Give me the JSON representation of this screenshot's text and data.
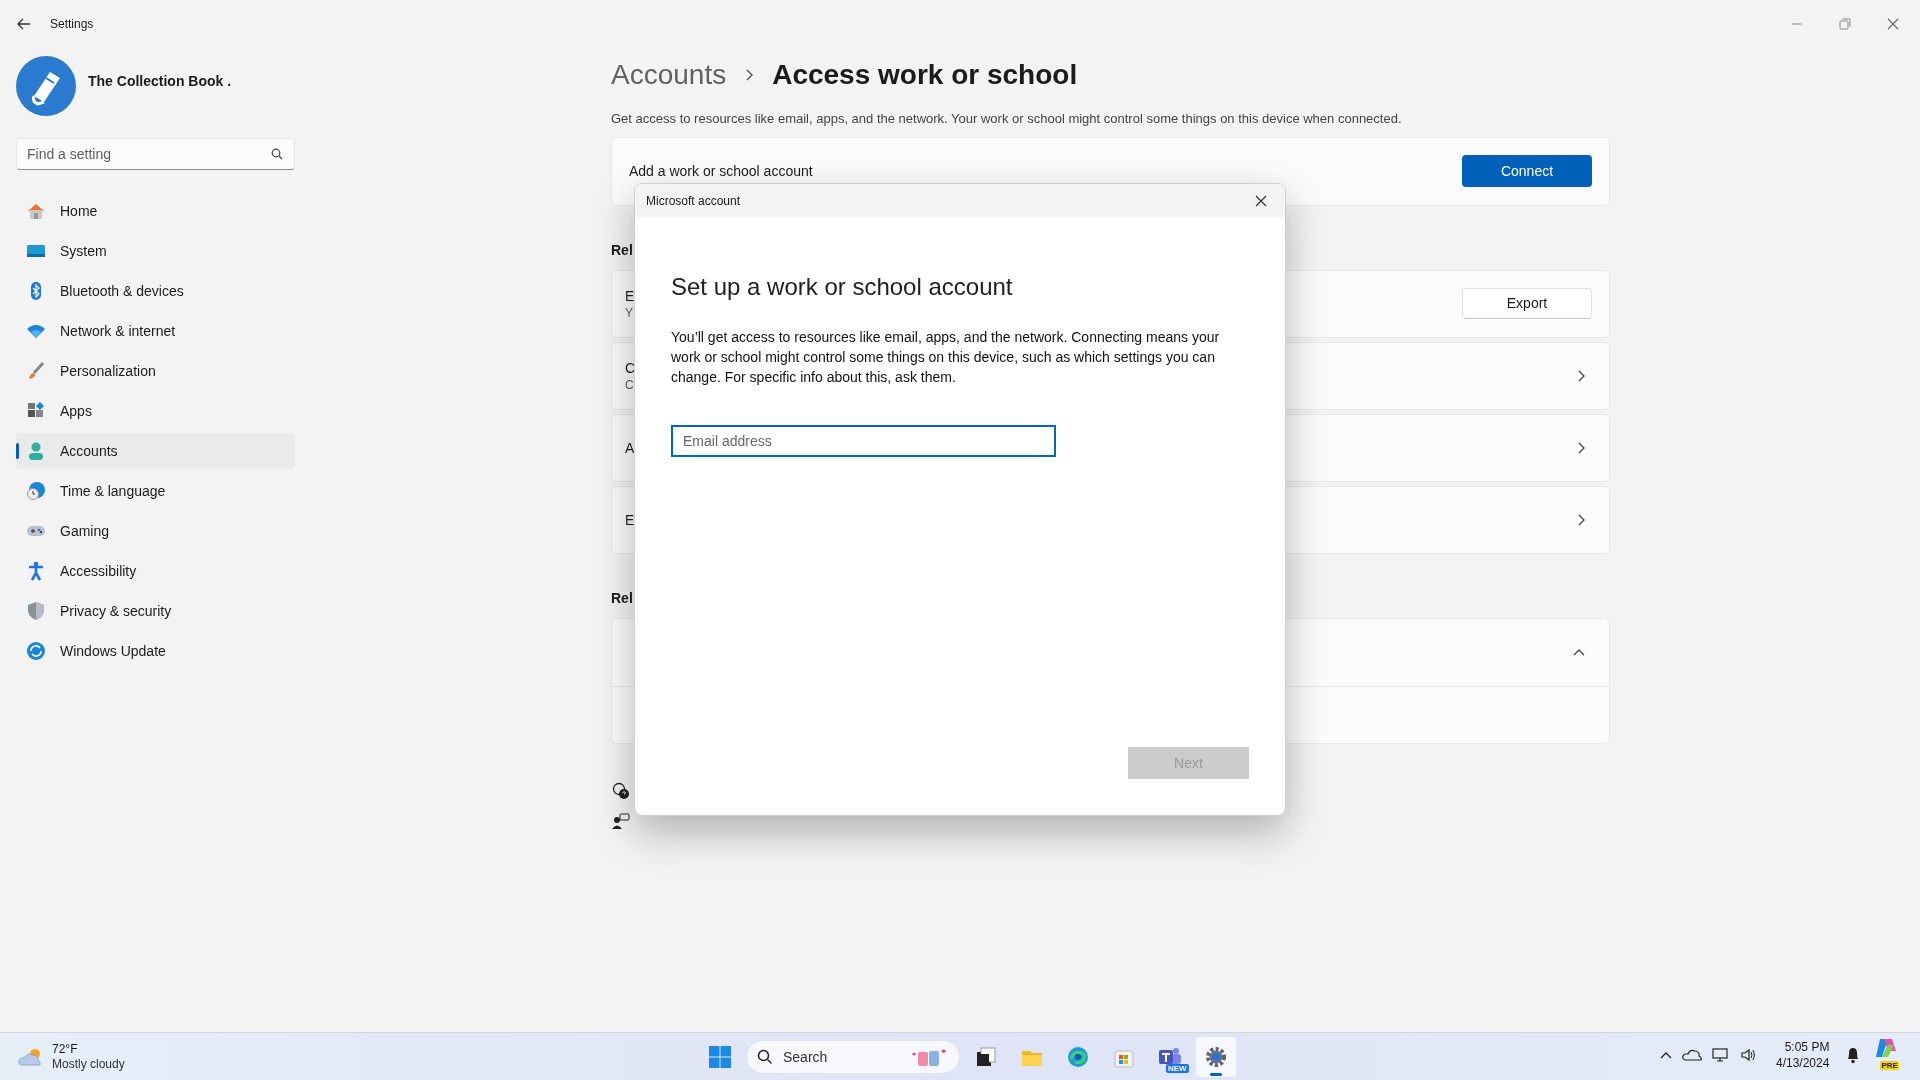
{
  "window": {
    "title": "Settings"
  },
  "profile": {
    "name": "The Collection Book ."
  },
  "search": {
    "placeholder": "Find a setting"
  },
  "nav": [
    {
      "label": "Home",
      "kind": "home",
      "selected": false
    },
    {
      "label": "System",
      "kind": "system",
      "selected": false
    },
    {
      "label": "Bluetooth & devices",
      "kind": "bluetooth",
      "selected": false
    },
    {
      "label": "Network & internet",
      "kind": "network",
      "selected": false
    },
    {
      "label": "Personalization",
      "kind": "brush",
      "selected": false
    },
    {
      "label": "Apps",
      "kind": "apps",
      "selected": false
    },
    {
      "label": "Accounts",
      "kind": "accounts",
      "selected": true
    },
    {
      "label": "Time & language",
      "kind": "time",
      "selected": false
    },
    {
      "label": "Gaming",
      "kind": "gaming",
      "selected": false
    },
    {
      "label": "Accessibility",
      "kind": "accessibility",
      "selected": false
    },
    {
      "label": "Privacy & security",
      "kind": "privacy",
      "selected": false
    },
    {
      "label": "Windows Update",
      "kind": "update",
      "selected": false
    }
  ],
  "page": {
    "breadcrumb": [
      "Accounts",
      "Access work or school"
    ],
    "description": "Get access to resources like email, apps, and the network. Your work or school might control some things on this device when connected.",
    "add_account": {
      "label": "Add a work or school account",
      "button": "Connect"
    },
    "section_1": {
      "heading": "Rel",
      "cards": [
        {
          "kind": "button",
          "line_1": "E",
          "line_2": "Y",
          "button": "Export"
        },
        {
          "kind": "link",
          "line_1": "C",
          "line_2": "C"
        },
        {
          "kind": "link",
          "line_1": "A"
        },
        {
          "kind": "link",
          "line_1": "E"
        }
      ]
    },
    "section_2": {
      "heading": "Rel",
      "cards": [
        {
          "kind": "expander",
          "expanded": true
        }
      ]
    }
  },
  "dialog": {
    "title": "Microsoft account",
    "heading": "Set up a work or school account",
    "body": "You’ll get access to resources like email, apps, and the network. Connecting means your work or school might control some things on this device, such as which settings you can change. For specific info about this, ask them.",
    "email": {
      "placeholder": "Email address"
    },
    "next": {
      "label": "Next",
      "disabled": true
    }
  },
  "taskbar": {
    "weather": {
      "temperature": "72°F",
      "condition": "Mostly cloudy"
    },
    "search": {
      "placeholder": "Search"
    },
    "apps": [
      {
        "kind": "taskview",
        "selected": false
      },
      {
        "kind": "explorer",
        "selected": false
      },
      {
        "kind": "edge",
        "selected": false
      },
      {
        "kind": "store",
        "selected": false
      },
      {
        "kind": "teams",
        "selected": false,
        "badge": "NEW"
      },
      {
        "kind": "settings",
        "selected": true
      }
    ],
    "clock": {
      "time": "5:05 PM",
      "date": "4/13/2024"
    },
    "copilot_badge": "PRE"
  }
}
